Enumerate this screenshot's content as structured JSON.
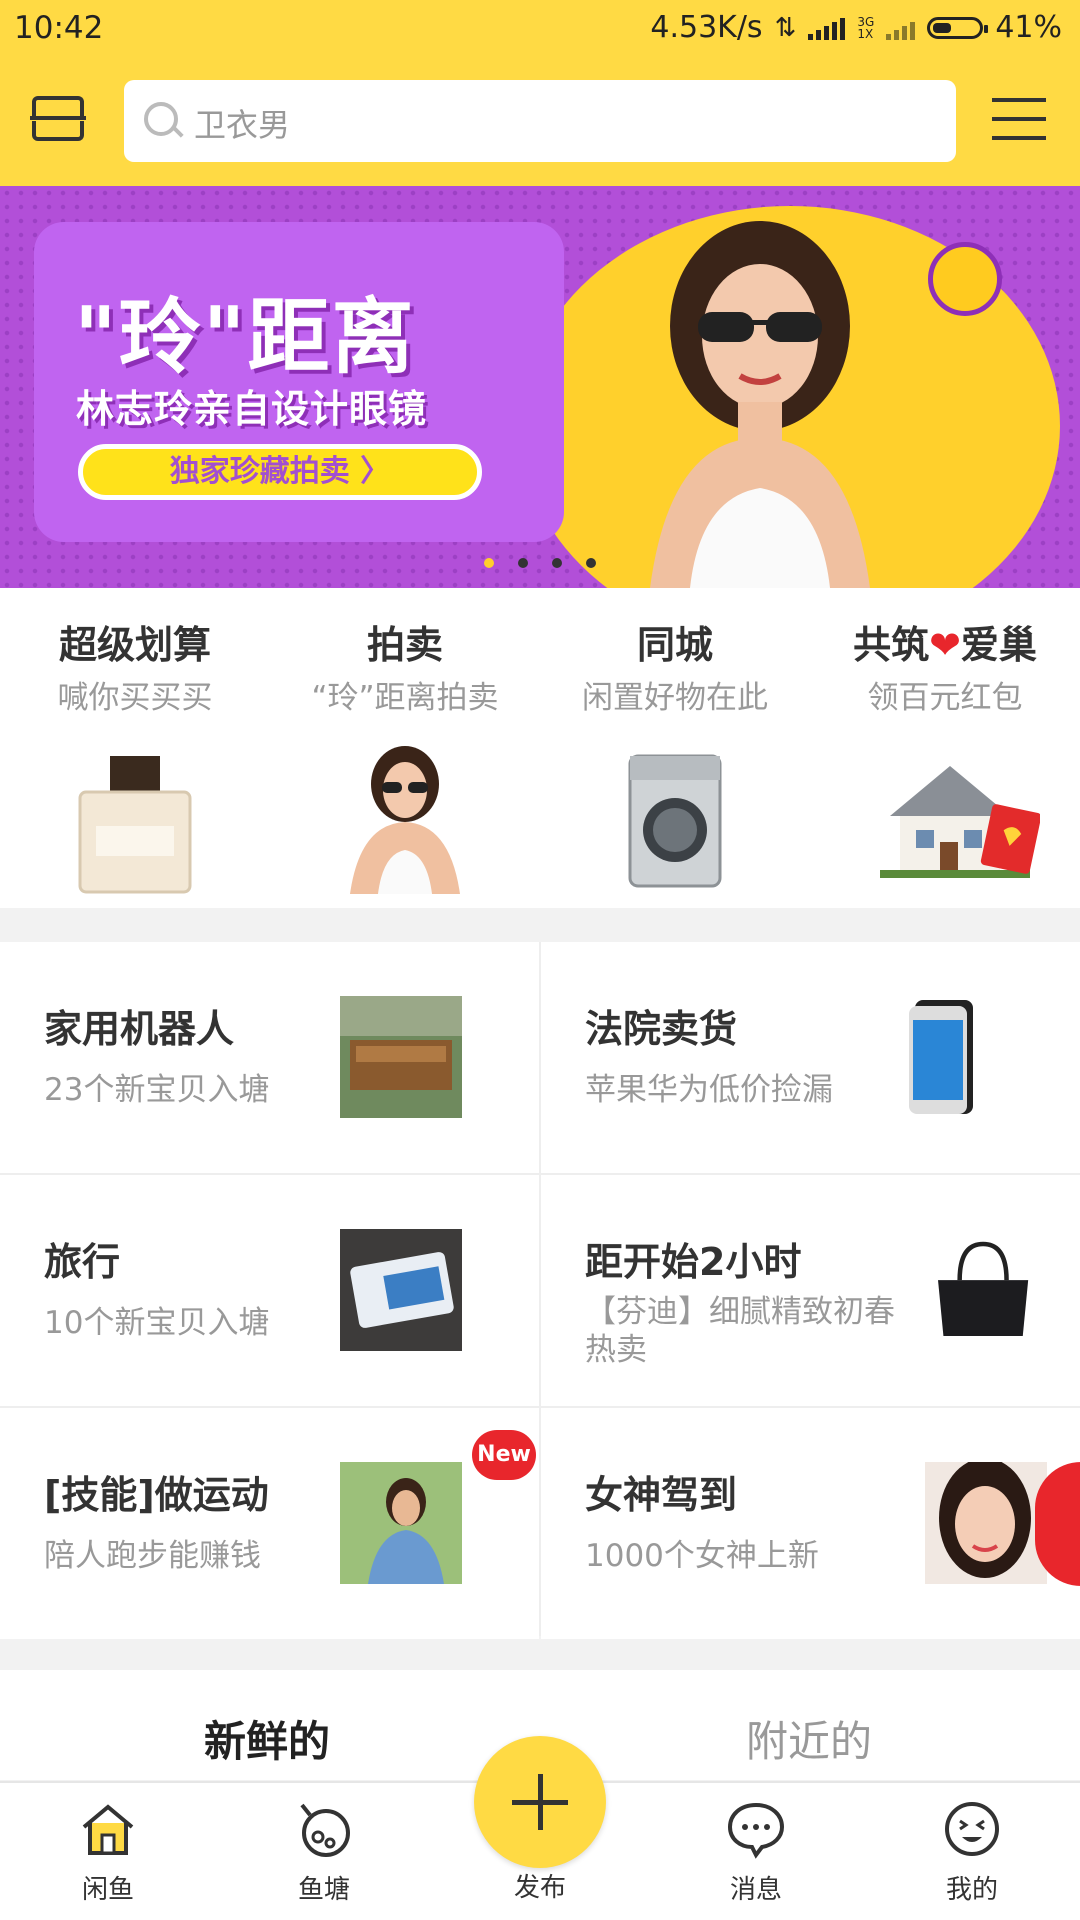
{
  "status": {
    "time": "10:42",
    "speed": "4.53K/s",
    "net_top": "3G",
    "net_bottom": "1X",
    "battery": "41%",
    "battery_level": 0.41
  },
  "header": {
    "search_placeholder": "卫衣男"
  },
  "banner": {
    "title": "\"玲\"距离",
    "subtitle": "林志玲亲自设计眼镜",
    "cta": "独家珍藏拍卖 〉",
    "page_count": 4,
    "active_page": 1
  },
  "quick": [
    {
      "title": "超级划算",
      "sub": "喊你买买买",
      "icon": "perfume-icon"
    },
    {
      "title": "拍卖",
      "sub": "“玲”距离拍卖",
      "icon": "model-photo"
    },
    {
      "title": "同城",
      "sub": "闲置好物在此",
      "icon": "washing-machine-icon"
    },
    {
      "title": "共筑❤爱巢",
      "sub": "领百元红包",
      "icon": "house-icon"
    }
  ],
  "ponds": [
    {
      "title": "家用机器人",
      "sub": "23个新宝贝入塘",
      "thumb": "furniture-photo"
    },
    {
      "title": "法院卖货",
      "sub": "苹果华为低价捡漏",
      "thumb": "phone-photo"
    },
    {
      "title": "旅行",
      "sub": "10个新宝贝入塘",
      "thumb": "card-photo"
    },
    {
      "title": "距开始2小时",
      "sub": "【芬迪】细腻精致初春热卖",
      "thumb": "handbag-photo"
    },
    {
      "title": "[技能]做运动",
      "sub": "陪人跑步能赚钱",
      "thumb": "runner-photo",
      "badge": "New"
    },
    {
      "title": "女神驾到",
      "sub": "1000个女神上新",
      "thumb": "portrait-photo"
    }
  ],
  "tabs": [
    {
      "label": "新鲜的",
      "active": true
    },
    {
      "label": "附近的",
      "active": false
    }
  ],
  "nav": [
    {
      "label": "闲鱼",
      "icon": "home-icon"
    },
    {
      "label": "鱼塘",
      "icon": "pond-icon"
    },
    {
      "label": "发布",
      "icon": "plus-icon"
    },
    {
      "label": "消息",
      "icon": "message-icon"
    },
    {
      "label": "我的",
      "icon": "profile-icon"
    }
  ],
  "colors": {
    "brand_yellow": "#ffda44",
    "banner_purple": "#b24fd8",
    "heart_red": "#e8262c"
  }
}
